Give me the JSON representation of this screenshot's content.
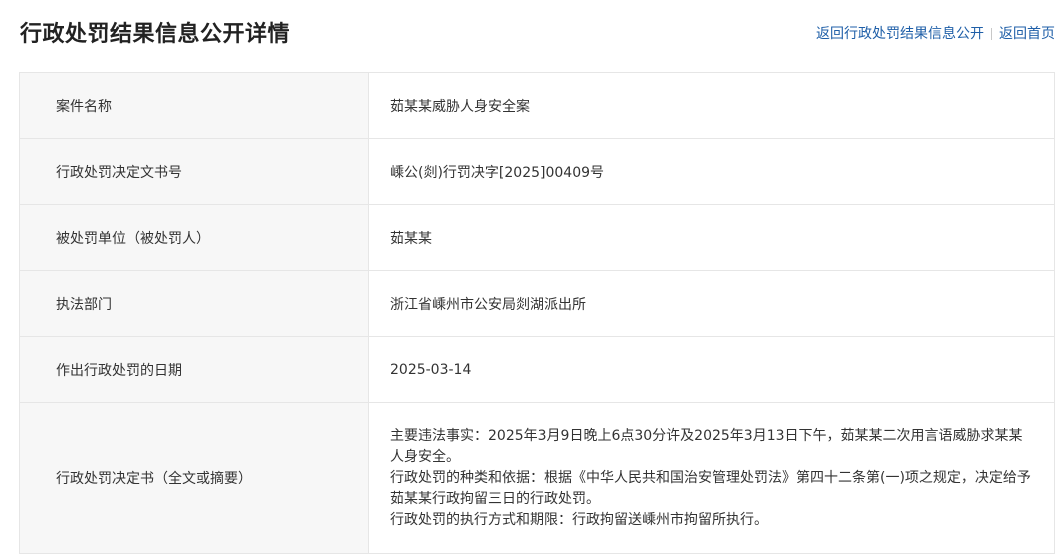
{
  "page": {
    "title": "行政处罚结果信息公开详情"
  },
  "nav": {
    "back_to_list": "返回行政处罚结果信息公开",
    "back_to_home": "返回首页"
  },
  "details": [
    {
      "label": "案件名称",
      "value": "茹某某威胁人身安全案"
    },
    {
      "label": "行政处罚决定文书号",
      "value": "嵊公(剡)行罚决字[2025]00409号"
    },
    {
      "label": "被处罚单位（被处罚人）",
      "value": "茹某某"
    },
    {
      "label": "执法部门",
      "value": "浙江省嵊州市公安局剡湖派出所"
    },
    {
      "label": "作出行政处罚的日期",
      "value": "2025-03-14"
    }
  ],
  "decision": {
    "label": "行政处罚决定书（全文或摘要）",
    "lines": [
      "主要违法事实：2025年3月9日晚上6点30分许及2025年3月13日下午，茹某某二次用言语威胁求某某人身安全。",
      "行政处罚的种类和依据：根据《中华人民共和国治安管理处罚法》第四十二条第(一)项之规定，决定给予茹某某行政拘留三日的行政处罚。",
      "行政处罚的执行方式和期限：行政拘留送嵊州市拘留所执行。"
    ]
  }
}
